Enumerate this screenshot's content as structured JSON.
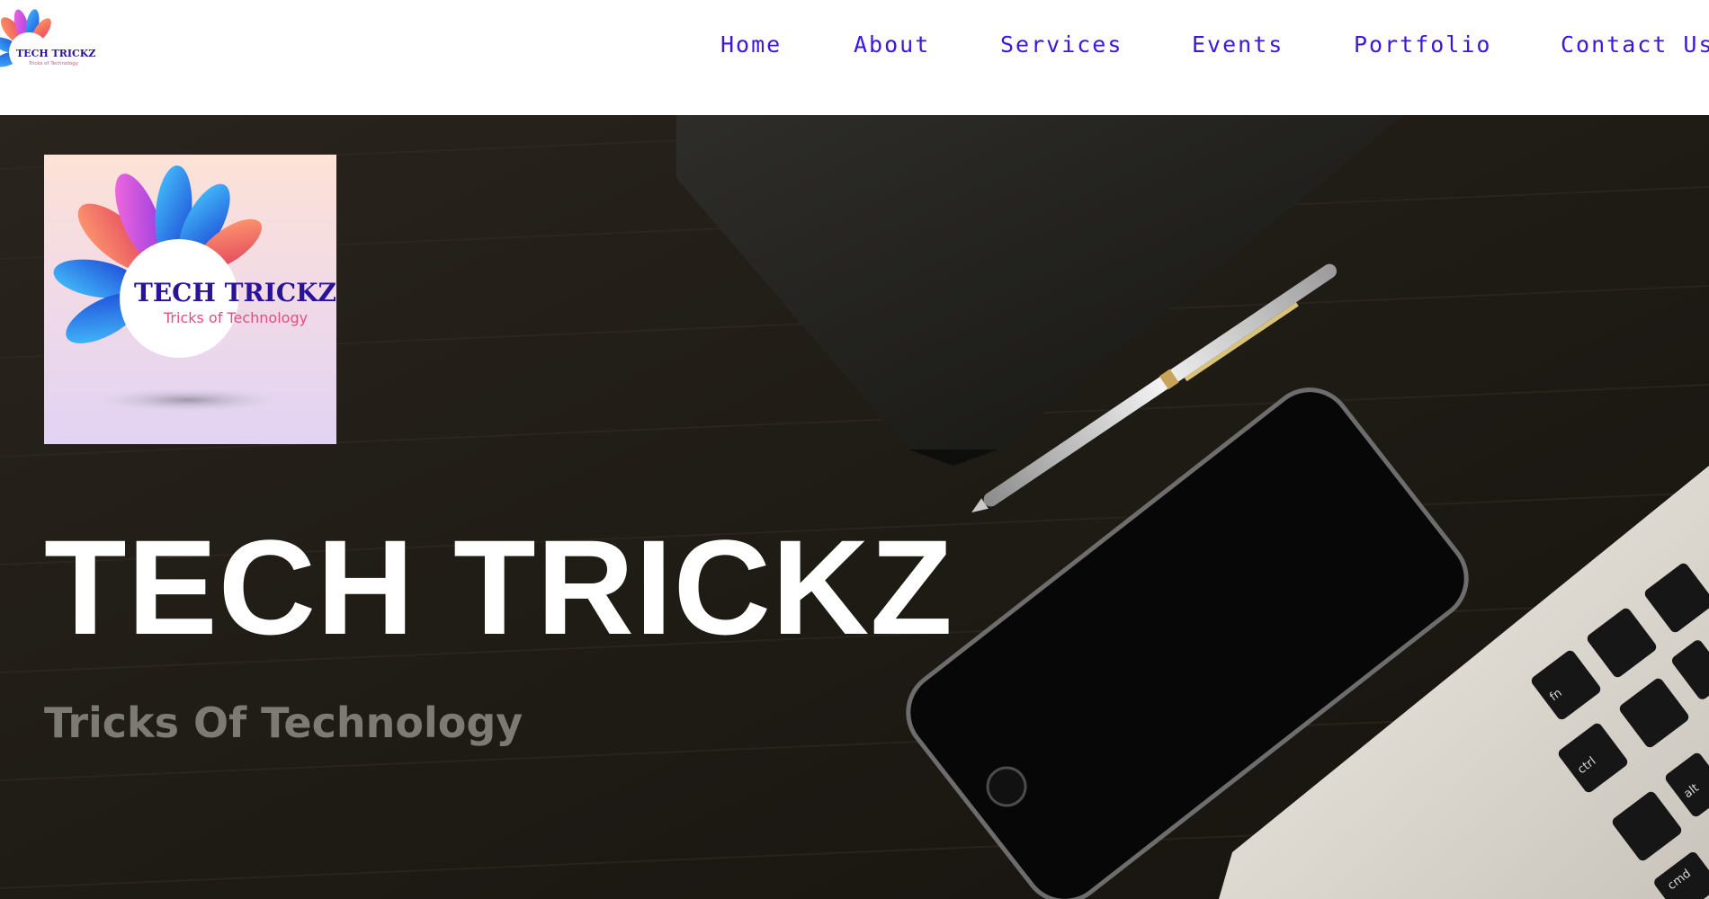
{
  "header": {
    "logo": {
      "icon": "lotus-logo-icon",
      "title": "TECH TRICKZ",
      "tagline": "Tricks of Technology"
    },
    "nav": [
      {
        "label": "Home"
      },
      {
        "label": "About"
      },
      {
        "label": "Services"
      },
      {
        "label": "Events"
      },
      {
        "label": "Portfolio"
      },
      {
        "label": "Contact Us"
      }
    ]
  },
  "hero": {
    "card": {
      "icon": "lotus-logo-icon",
      "title": "TECH TRICKZ",
      "tagline": "Tricks of Technology"
    },
    "title": "TECH TRICKZ",
    "subtitle": "Tricks Of Technology",
    "background_icons": [
      "notebook-icon",
      "pen-icon",
      "smartphone-icon",
      "laptop-keyboard-icon"
    ],
    "keyboard_keys": [
      "fn",
      "ctrl",
      "alt",
      "cmd"
    ]
  },
  "colors": {
    "nav_link": "#3b17e0",
    "logo_title": "#2a1299",
    "logo_tagline": "#e0507a",
    "hero_bg": "#1d1913",
    "hero_title": "#ffffff",
    "hero_subtitle": "#7d7a74"
  }
}
